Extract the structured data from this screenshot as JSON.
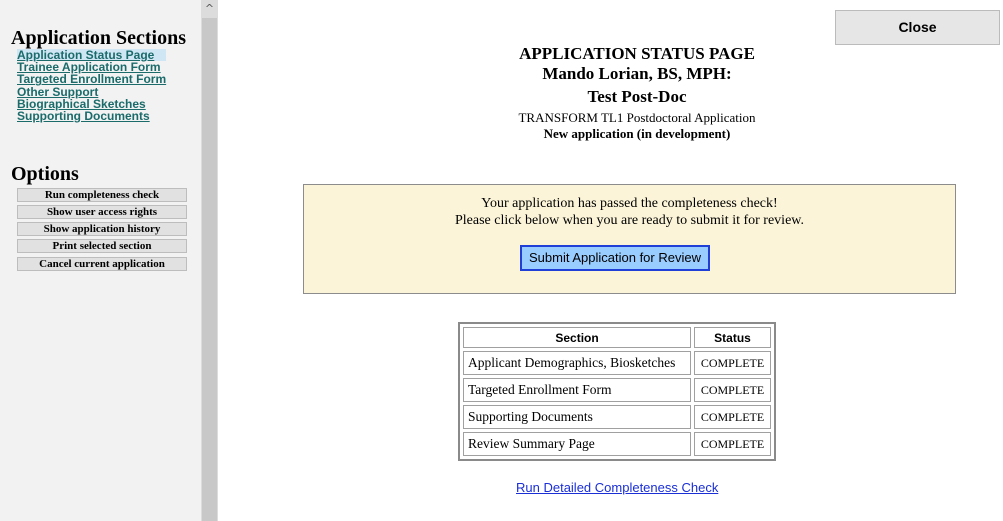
{
  "sidebar": {
    "sections_heading": "Application Sections",
    "sections": [
      "Application Status Page",
      "Trainee Application Form",
      "Targeted Enrollment Form",
      "Other Support",
      "Biographical Sketches",
      "Supporting Documents"
    ],
    "options_heading": "Options",
    "options": [
      "Run completeness check",
      "Show user access rights",
      "Show application history",
      "Print selected section",
      "Cancel current application"
    ]
  },
  "scrollbar": {
    "up_arrow": "^"
  },
  "header": {
    "close_label": "Close",
    "page_title": "APPLICATION STATUS PAGE",
    "applicant_name": "Mando Lorian, BS, MPH:",
    "applicant_title": "Test Post-Doc",
    "program": "TRANSFORM TL1 Postdoctoral Application",
    "status": "New application (in development)"
  },
  "notice": {
    "line1": "Your application has passed the completeness check!",
    "line2": "Please click below when you are ready to submit it for review.",
    "submit_label": "Submit Application for Review"
  },
  "table": {
    "headers": [
      "Section",
      "Status"
    ],
    "rows": [
      {
        "section": "Applicant Demographics, Biosketches",
        "status": "COMPLETE"
      },
      {
        "section": "Targeted Enrollment Form",
        "status": "COMPLETE"
      },
      {
        "section": "Supporting Documents",
        "status": "COMPLETE"
      },
      {
        "section": "Review Summary Page",
        "status": "COMPLETE"
      }
    ]
  },
  "footer_link": "Run Detailed Completeness Check",
  "colors": {
    "sidebar_link": "#1b6b6b",
    "notice_bg": "#fbf4d8",
    "submit_bg": "#99ccff",
    "submit_border": "#1f3fd6",
    "link_blue": "#1a2fd6"
  }
}
